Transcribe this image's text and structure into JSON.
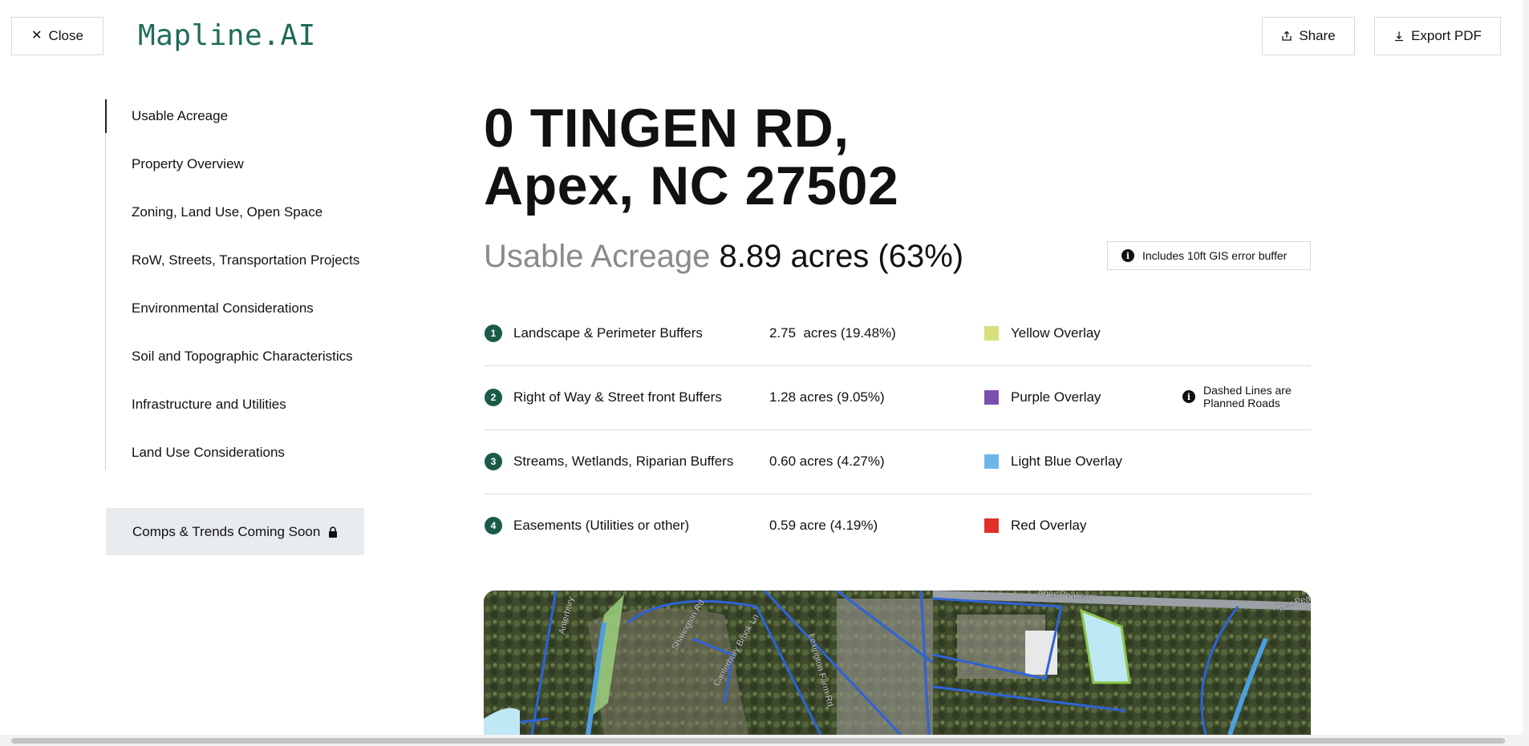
{
  "header": {
    "close_label": "Close",
    "logo": "Mapline.AI",
    "share_label": "Share",
    "export_label": "Export PDF"
  },
  "sidebar": {
    "items": [
      {
        "label": "Usable Acreage",
        "active": true
      },
      {
        "label": "Property Overview"
      },
      {
        "label": "Zoning, Land Use, Open Space"
      },
      {
        "label": "RoW, Streets, Transportation Projects"
      },
      {
        "label": "Environmental Considerations"
      },
      {
        "label": "Soil and Topographic Characteristics"
      },
      {
        "label": "Infrastructure and Utilities"
      },
      {
        "label": "Land Use Considerations"
      }
    ],
    "comps_label": "Comps & Trends Coming Soon"
  },
  "main": {
    "address_line1": "0 TINGEN RD,",
    "address_line2": "Apex, NC 27502",
    "usable_label": "Usable Acreage",
    "usable_value": "8.89 acres (63%)",
    "buffer_note": "Includes 10ft GIS error buffer",
    "rows": [
      {
        "num": "1",
        "category": "Landscape & Perimeter Buffers",
        "acres": "2.75  acres (19.48%)",
        "overlay": "Yellow Overlay",
        "color": "#d9df7e"
      },
      {
        "num": "2",
        "category": "Right of Way & Street front Buffers",
        "acres": "1.28 acres (9.05%)",
        "overlay": "Purple Overlay",
        "color": "#7b4fb0",
        "note": "Dashed Lines are Planned Roads"
      },
      {
        "num": "3",
        "category": "Streams, Wetlands, Riparian Buffers",
        "acres": "0.60 acres (4.27%)",
        "overlay": "Light Blue Overlay",
        "color": "#6eb6ea"
      },
      {
        "num": "4",
        "category": "Easements (Utilities or other)",
        "acres": "0.59 acre (4.19%)",
        "overlay": "Red Overlay",
        "color": "#e0302a"
      }
    ]
  },
  "map": {
    "street_labels": [
      "Anterbury",
      "Sharington Rd",
      "Canterbury Brook Ln",
      "Lexington Farm Rd",
      "Apex Peakway",
      "Apex Pea"
    ]
  }
}
